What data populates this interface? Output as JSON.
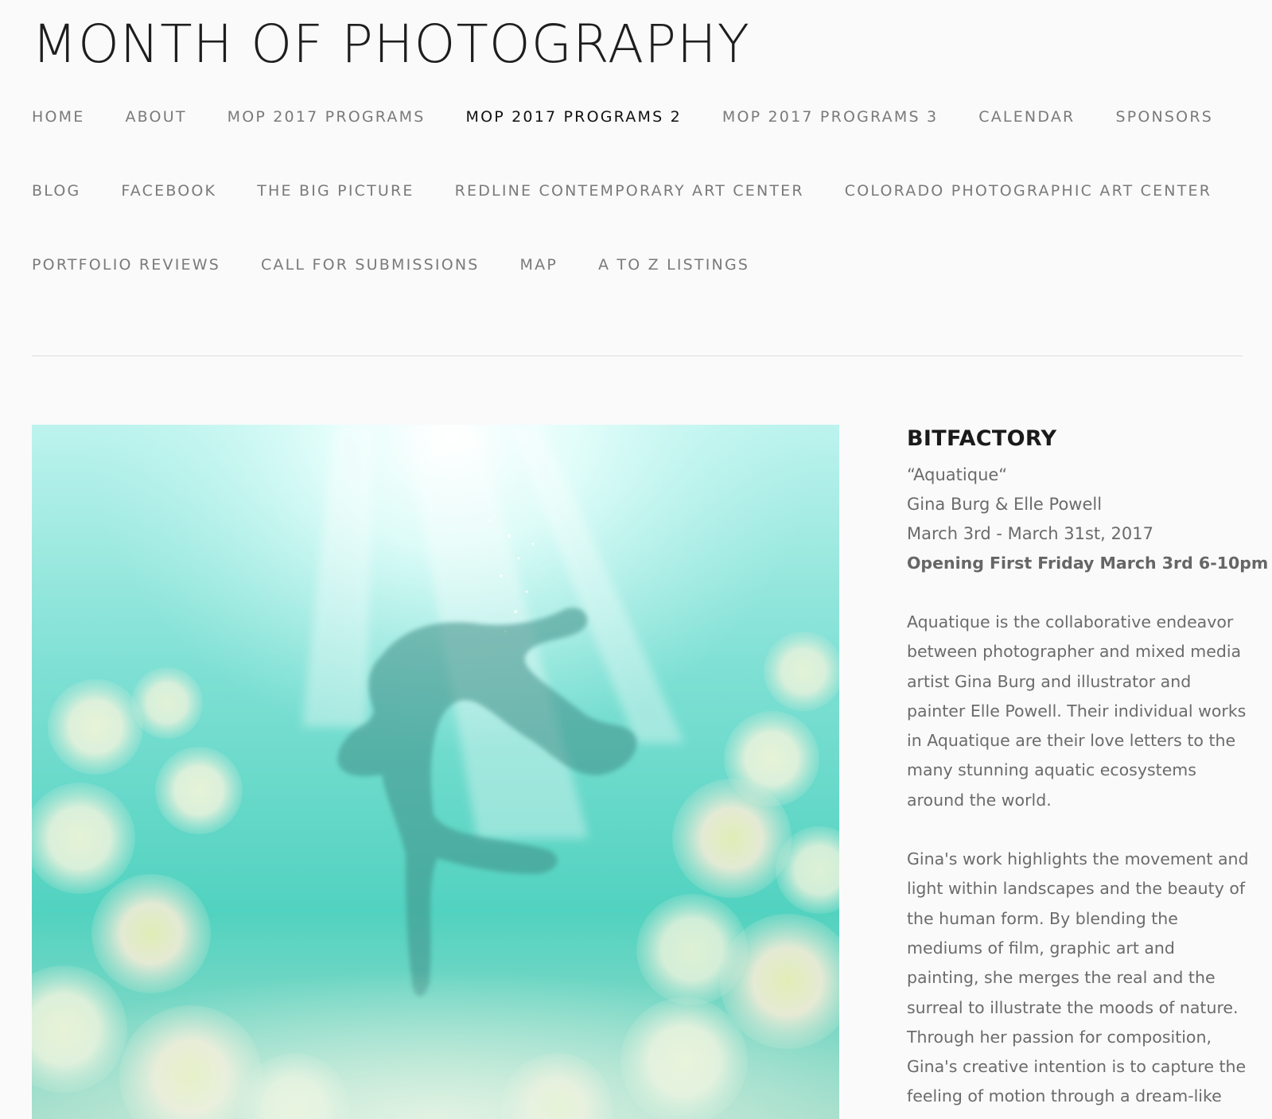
{
  "site": {
    "title": "MONTH OF PHOTOGRAPHY"
  },
  "nav": {
    "row1": [
      {
        "label": "HOME"
      },
      {
        "label": "ABOUT"
      },
      {
        "label": "MOP 2017 PROGRAMS"
      },
      {
        "label": "MOP 2017 PROGRAMS 2"
      },
      {
        "label": "MOP 2017 PROGRAMS 3"
      },
      {
        "label": "CALENDAR"
      },
      {
        "label": "SPONSORS"
      }
    ],
    "row2": [
      {
        "label": "BLOG"
      },
      {
        "label": "FACEBOOK"
      },
      {
        "label": "THE BIG PICTURE"
      },
      {
        "label": "REDLINE CONTEMPORARY ART CENTER"
      },
      {
        "label": "COLORADO PHOTOGRAPHIC ART CENTER"
      }
    ],
    "row3": [
      {
        "label": "PORTFOLIO REVIEWS"
      },
      {
        "label": "CALL FOR SUBMISSIONS"
      },
      {
        "label": "MAP"
      },
      {
        "label": "A TO Z LISTINGS"
      }
    ],
    "active": "MOP 2017 PROGRAMS 2"
  },
  "colors": {
    "background": "#fafafa",
    "title": "#1e1e1e",
    "nav_text": "#7a7a7a",
    "nav_active": "#111111",
    "body_text": "#6b6b6b",
    "water": "#4fd3c0"
  },
  "event": {
    "title": "BITFACTORY",
    "show_name": "“Aquatique“",
    "artists": "Gina Burg & Elle Powell",
    "dates": "March 3rd - March 31st, 2017",
    "opening": "Opening First Friday March 3rd 6-10pm",
    "paragraphs": [
      "Aquatique is the collaborative endeavor between photographer and mixed media artist Gina Burg and illustrator and painter Elle Powell. Their individual works in Aquatique are their love letters to the many stunning aquatic ecosystems around the world.",
      "Gina's work highlights the movement and light within landscapes and the beauty of the human form. By blending the mediums of film, graphic art and painting, she merges the real and the surreal to illustrate the moods of nature. Through her passion for composition, Gina's creative intention is to capture the feeling of motion through a dream-like"
    ]
  }
}
